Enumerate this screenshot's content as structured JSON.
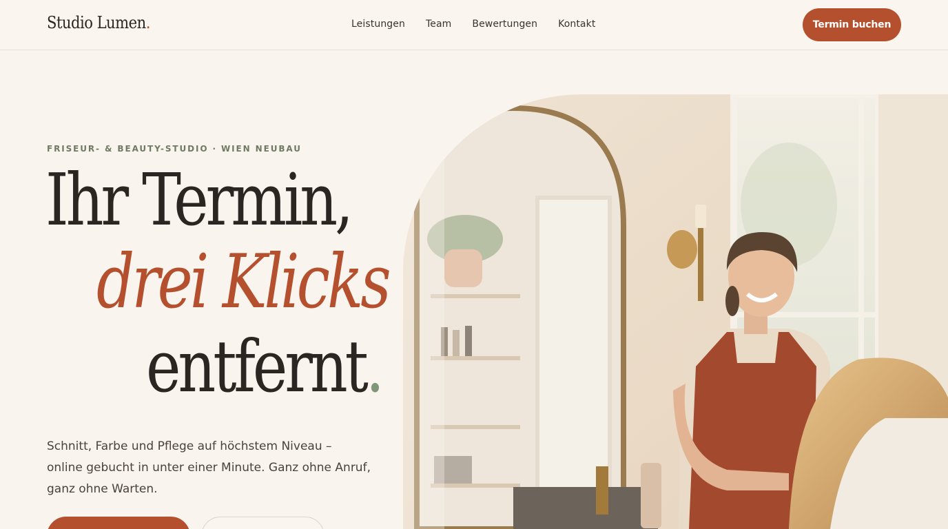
{
  "header": {
    "logo_text": "Studio Lumen",
    "logo_dot": ".",
    "nav": [
      "Leistungen",
      "Team",
      "Bewertungen",
      "Kontakt"
    ],
    "cta_label": "Termin buchen"
  },
  "hero": {
    "eyebrow": "FRISEUR- & BEAUTY-STUDIO · WIEN NEUBAU",
    "headline_line1": "Ihr Termin,",
    "headline_line2": "drei Klicks",
    "headline_line3": "entfernt",
    "headline_period": ".",
    "lead": "Schnitt, Farbe und Pflege auf höchstem Niveau – online gebucht in unter einer Minute. Ganz ohne Anruf, ganz ohne Warten."
  },
  "colors": {
    "background": "#f9f4ee",
    "accent": "#b5502f",
    "sage": "#7f9779",
    "text": "#2b2622"
  }
}
